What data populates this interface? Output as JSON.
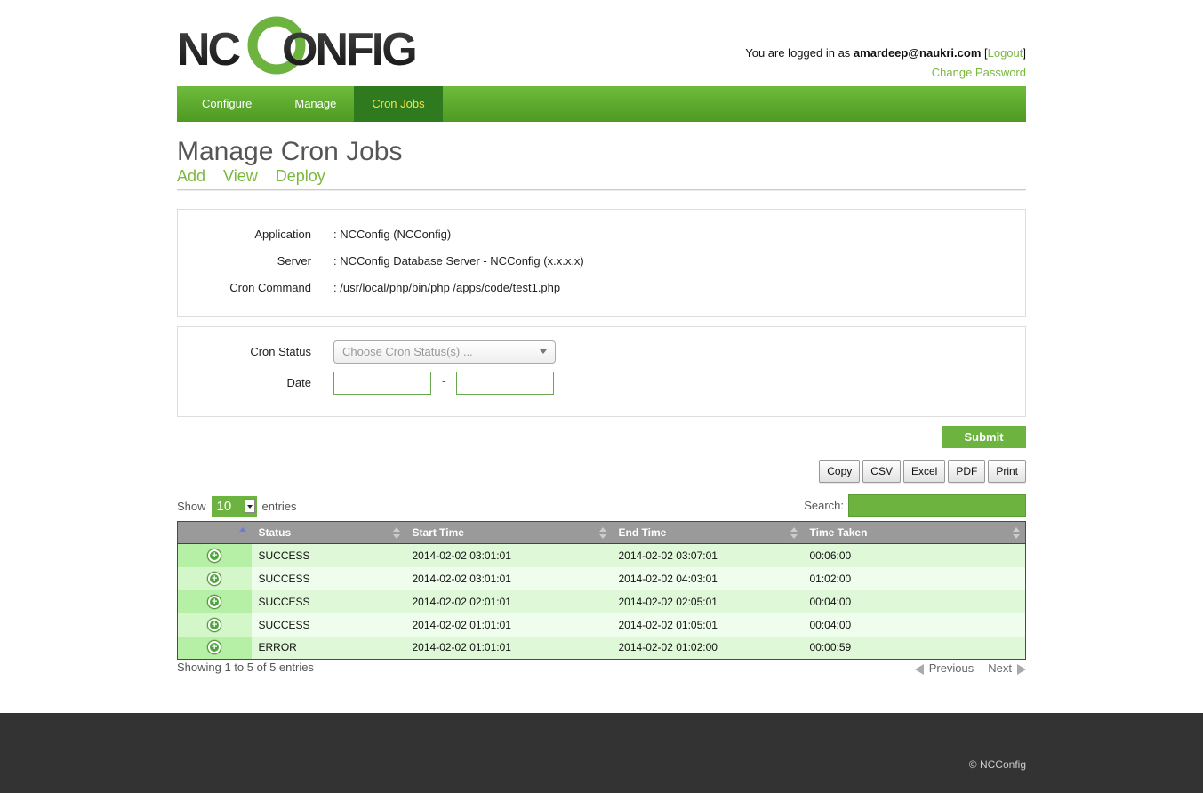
{
  "header": {
    "logo_text": "NCCONFIG",
    "logged_in_prefix": "You are logged in as",
    "user_email": "amardeep@naukri.com",
    "logout_label": "Logout",
    "change_password_label": "Change Password"
  },
  "nav": {
    "items": [
      {
        "label": "Configure"
      },
      {
        "label": "Manage"
      },
      {
        "label": "Cron Jobs"
      }
    ],
    "active": "Cron Jobs"
  },
  "page": {
    "title": "Manage Cron Jobs",
    "subnav": [
      "Add",
      "View",
      "Deploy"
    ]
  },
  "details": {
    "application_label": "Application",
    "application_value": ": NCConfig (NCConfig)",
    "server_label": "Server",
    "server_value": ": NCConfig Database Server - NCConfig (x.x.x.x)",
    "command_label": "Cron Command",
    "command_value": ": /usr/local/php/bin/php /apps/code/test1.php"
  },
  "filters": {
    "status_label": "Cron Status",
    "status_placeholder": "Choose Cron Status(s) ...",
    "date_label": "Date",
    "date_separator": "-",
    "submit_label": "Submit"
  },
  "tools": [
    "Copy",
    "CSV",
    "Excel",
    "PDF",
    "Print"
  ],
  "table_controls": {
    "show_label": "Show",
    "length_value": "10",
    "entries_label": "entries",
    "search_label": "Search:"
  },
  "table": {
    "columns": [
      "",
      "Status",
      "Start Time",
      "End Time",
      "Time Taken"
    ],
    "rows": [
      {
        "status": "SUCCESS",
        "start": "2014-02-02 03:01:01",
        "end": "2014-02-02 03:07:01",
        "taken": "00:06:00"
      },
      {
        "status": "SUCCESS",
        "start": "2014-02-02 03:01:01",
        "end": "2014-02-02 04:03:01",
        "taken": "01:02:00"
      },
      {
        "status": "SUCCESS",
        "start": "2014-02-02 02:01:01",
        "end": "2014-02-02 02:05:01",
        "taken": "00:04:00"
      },
      {
        "status": "SUCCESS",
        "start": "2014-02-02 01:01:01",
        "end": "2014-02-02 01:05:01",
        "taken": "00:04:00"
      },
      {
        "status": "ERROR",
        "start": "2014-02-02 01:01:01",
        "end": "2014-02-02 01:02:00",
        "taken": "00:00:59"
      }
    ]
  },
  "pagination": {
    "info": "Showing 1 to 5 of 5 entries",
    "previous_label": "Previous",
    "next_label": "Next"
  },
  "footer": {
    "copyright": "© NCConfig"
  },
  "colors": {
    "brand_green": "#6cb33f",
    "nav_active_bg": "#2f7a1e",
    "nav_active_text": "#f4e34a",
    "footer_bg": "#333333"
  }
}
